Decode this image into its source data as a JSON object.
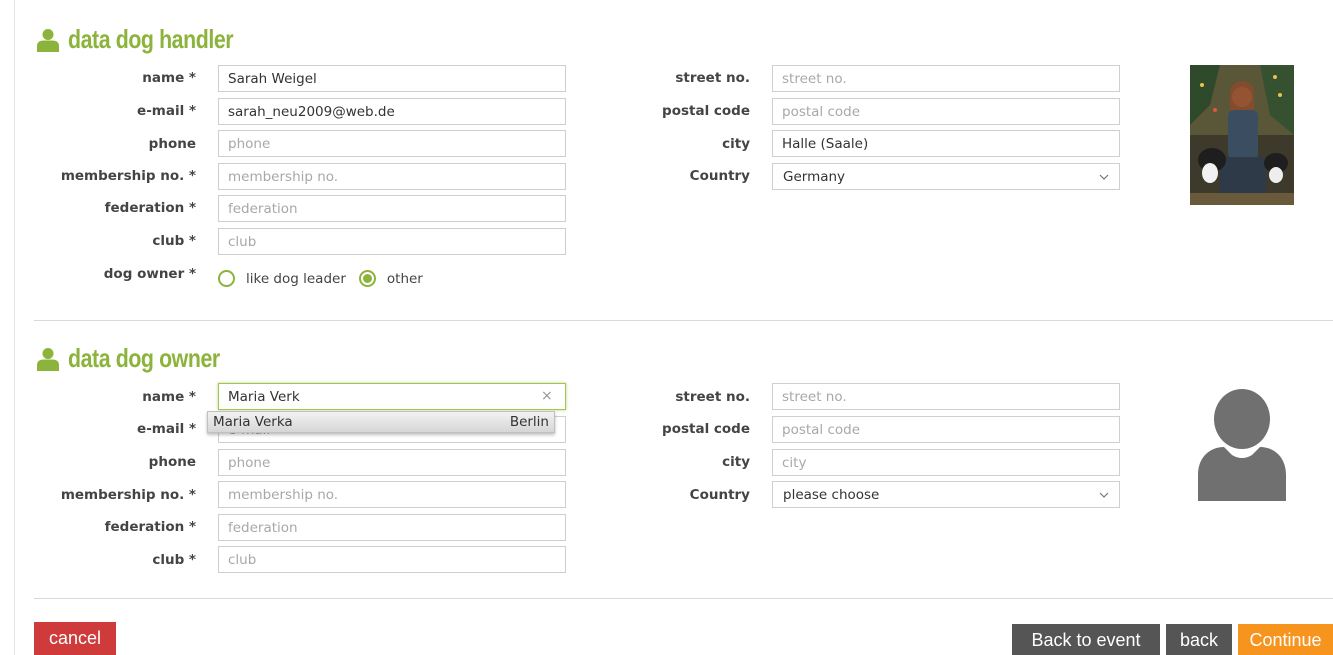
{
  "handler": {
    "title": "data dog handler",
    "labels": {
      "name": "name *",
      "email": "e-mail *",
      "phone": "phone",
      "membership": "membership no. *",
      "federation": "federation *",
      "club": "club *",
      "dog_owner": "dog owner *",
      "street": "street no.",
      "postal": "postal code",
      "city": "city",
      "country": "Country"
    },
    "values": {
      "name": "Sarah Weigel",
      "email": "sarah_neu2009@web.de",
      "city": "Halle (Saale)",
      "country": "Germany"
    },
    "placeholders": {
      "phone": "phone",
      "membership": "membership no.",
      "federation": "federation",
      "club": "club",
      "street": "street no.",
      "postal": "postal code"
    },
    "dog_owner_options": [
      "like dog leader",
      "other"
    ],
    "dog_owner_selected": "other"
  },
  "owner": {
    "title": "data dog owner",
    "labels": {
      "name": "name *",
      "email": "e-mail *",
      "phone": "phone",
      "membership": "membership no. *",
      "federation": "federation *",
      "club": "club *",
      "street": "street no.",
      "postal": "postal code",
      "city": "city",
      "country": "Country"
    },
    "values": {
      "name": "Maria Verk",
      "country": "please choose"
    },
    "placeholders": {
      "email": "e-mail",
      "phone": "phone",
      "membership": "membership no.",
      "federation": "federation",
      "club": "club",
      "street": "street no.",
      "postal": "postal code",
      "city": "city"
    },
    "autocomplete": {
      "name": "Maria Verka",
      "city": "Berlin"
    },
    "clear_glyph": "×"
  },
  "buttons": {
    "cancel": "cancel",
    "back_to_event": "Back to event",
    "back": "back",
    "continue": "Continue"
  },
  "colors": {
    "accent_green": "#8cb33b",
    "cancel_red": "#cf3b3b",
    "dark_button": "#555555",
    "continue_orange": "#f7941d"
  },
  "icons": {
    "section": "person-icon",
    "select": "chevron-down-icon",
    "owner_avatar": "user-placeholder-icon"
  }
}
